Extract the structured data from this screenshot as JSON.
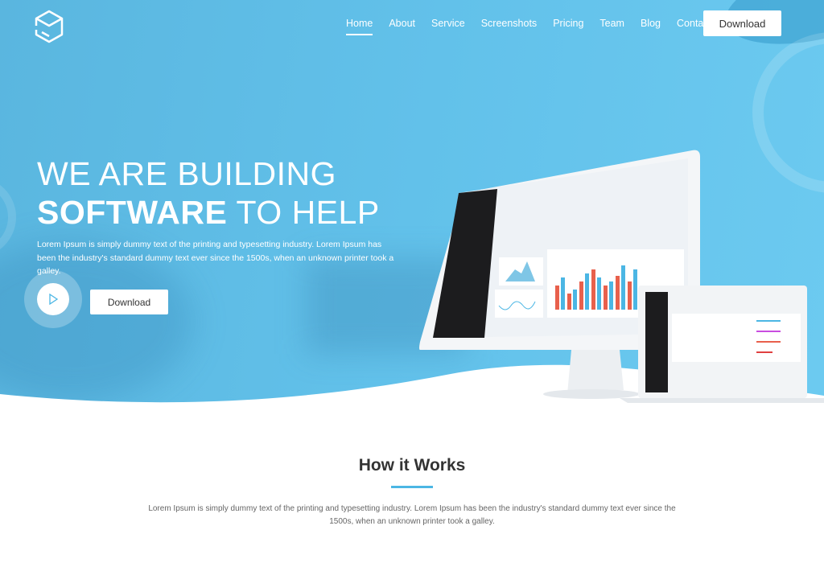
{
  "nav": {
    "items": [
      {
        "label": "Home",
        "active": true
      },
      {
        "label": "About"
      },
      {
        "label": "Service"
      },
      {
        "label": "Screenshots"
      },
      {
        "label": "Pricing"
      },
      {
        "label": "Team"
      },
      {
        "label": "Blog"
      },
      {
        "label": "Contact"
      }
    ],
    "download_label": "Download"
  },
  "hero": {
    "title_line1": "WE ARE BUILDING",
    "title_bold": "SOFTWARE",
    "title_rest": " TO HELP",
    "lead": "Lorem Ipsum is simply dummy text of the printing and typesetting industry. Lorem Ipsum has been the industry's standard dummy text ever since the 1500s, when an unknown printer took a galley.",
    "download_label": "Download",
    "play_icon": "play-icon"
  },
  "how": {
    "title": "How it Works",
    "text": "Lorem Ipsum is simply dummy text of the printing and typesetting industry. Lorem Ipsum has been the industry's standard dummy text ever since the 1500s, when an unknown printer took a galley."
  },
  "colors": {
    "hero": "#62c1ea",
    "accent": "#4bb6e4",
    "bar_red": "#e8604c",
    "bar_blue": "#4bb6e4"
  }
}
